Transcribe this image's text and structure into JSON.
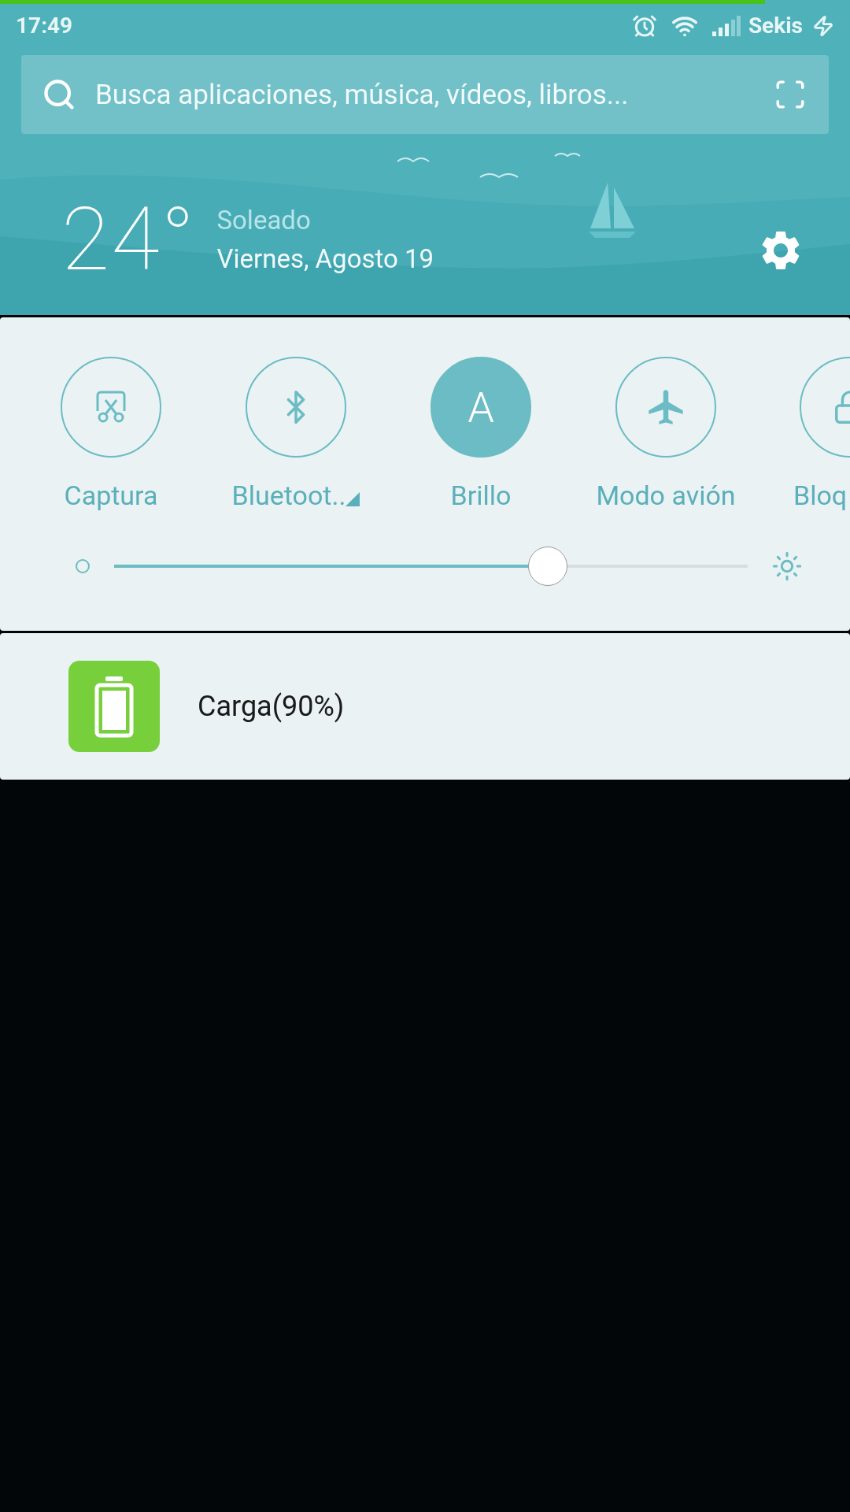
{
  "top_progress": {
    "level": 0.9
  },
  "status_bar": {
    "time": "17:49",
    "carrier": "Sekis"
  },
  "search": {
    "placeholder": "Busca aplicaciones, música, vídeos, libros..."
  },
  "weather": {
    "temperature": "24°",
    "condition": "Soleado",
    "date": "Viernes, Agosto 19"
  },
  "toggles": [
    {
      "kind": "screenshot",
      "label": "Captura",
      "on": false
    },
    {
      "kind": "bluetooth",
      "label": "Bluetoot..",
      "on": false,
      "has_menu": true
    },
    {
      "kind": "letter",
      "glyph": "A",
      "label": "Brillo",
      "on": true
    },
    {
      "kind": "airplane",
      "label": "Modo avión",
      "on": false
    },
    {
      "kind": "lock",
      "label": "Bloq",
      "on": false
    }
  ],
  "brightness": {
    "level": 0.685
  },
  "notifications": [
    {
      "title": "Carga(90%)"
    }
  ]
}
